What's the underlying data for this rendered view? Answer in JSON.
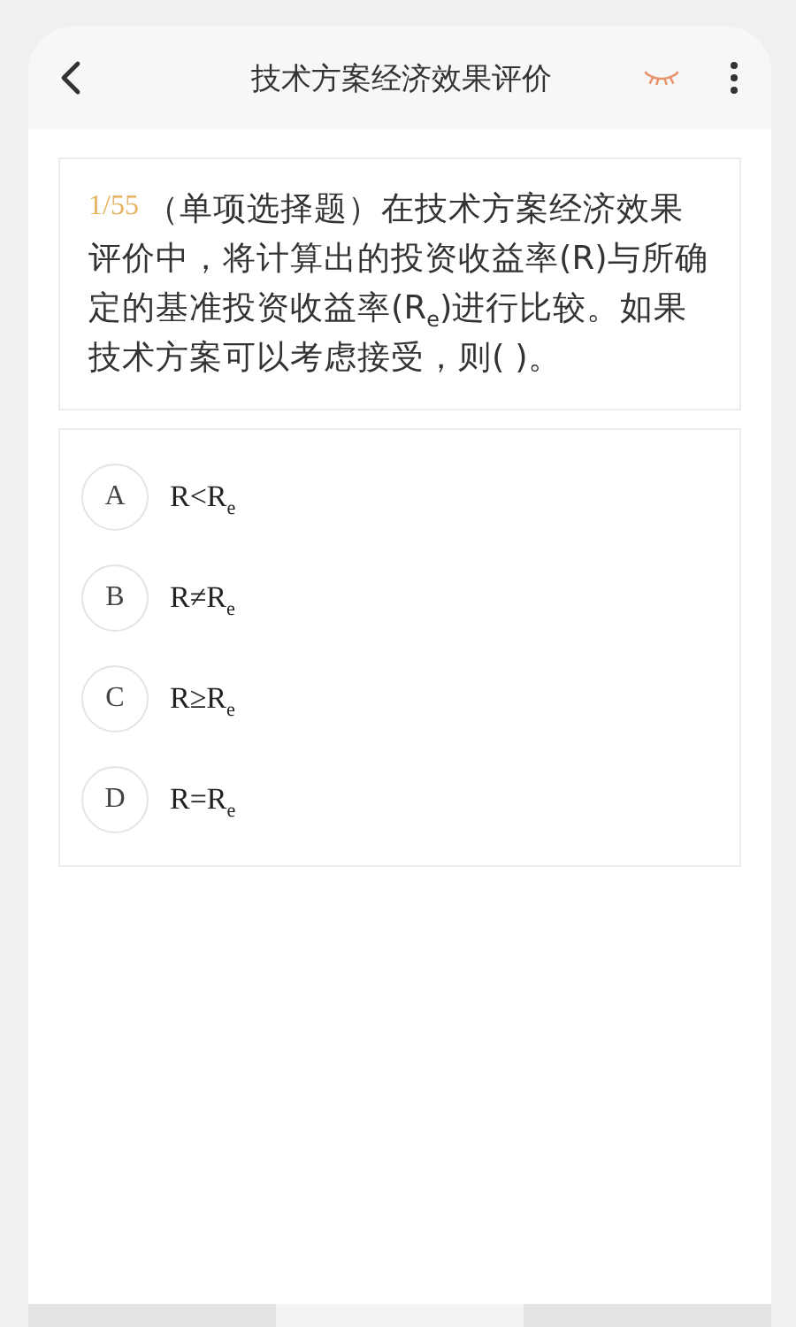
{
  "header": {
    "title": "技术方案经济效果评价"
  },
  "question": {
    "number": "1/55",
    "text": "（单项选择题）在技术方案经济效果评价中，将计算出的投资收益率(R)与所确定的基准投资收益率(R$_{e}$)进行比较。如果技术方案可以考虑接受，则( )。"
  },
  "options": [
    {
      "letter": "A",
      "text": "R<R$_{e}$",
      "selected": false
    },
    {
      "letter": "B",
      "text": "R≠R$_{e}$",
      "selected": false
    },
    {
      "letter": "C",
      "text": "R≥R$_{e}$",
      "selected": false
    },
    {
      "letter": "D",
      "text": "R=R$_{e}$",
      "selected": false
    }
  ]
}
